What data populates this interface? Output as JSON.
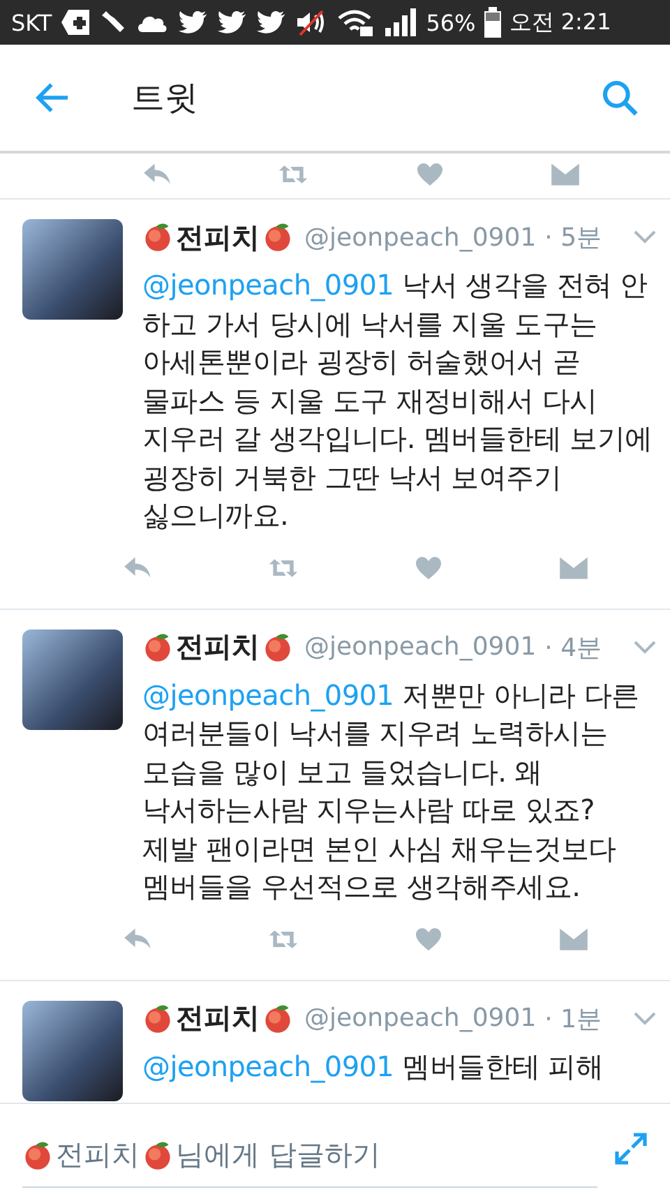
{
  "status_bar": {
    "carrier": "SKT",
    "battery": "56%",
    "time": "오전 2:21"
  },
  "app_bar": {
    "title": "트윗"
  },
  "tweets": [
    {
      "name": "전피치",
      "handle": "@jeonpeach_0901",
      "time": "· 5분",
      "mention": "@jeonpeach_0901",
      "text": "낙서 생각을 전혀 안 하고 가서 당시에 낙서를 지울 도구는 아세톤뿐이라 굉장히 허술했어서 곧 물파스 등 지울 도구 재정비해서 다시 지우러 갈 생각입니다. 멤버들한테 보기에 굉장히 거북한 그딴 낙서 보여주기 싫으니까요."
    },
    {
      "name": "전피치",
      "handle": "@jeonpeach_0901",
      "time": "· 4분",
      "mention": "@jeonpeach_0901",
      "text": "저뿐만 아니라 다른 여러분들이 낙서를 지우려 노력하시는 모습을 많이 보고 들었습니다. 왜 낙서하는사람 지우는사람 따로 있죠? 제발 팬이라면 본인 사심 채우는것보다 멤버들을 우선적으로 생각해주세요."
    },
    {
      "name": "전피치",
      "handle": "@jeonpeach_0901",
      "time": "· 1분",
      "mention": "@jeonpeach_0901",
      "text": "멤버들한테 피해"
    }
  ],
  "reply_bar": {
    "name": "전피치",
    "placeholder": "님에게 답글하기"
  }
}
